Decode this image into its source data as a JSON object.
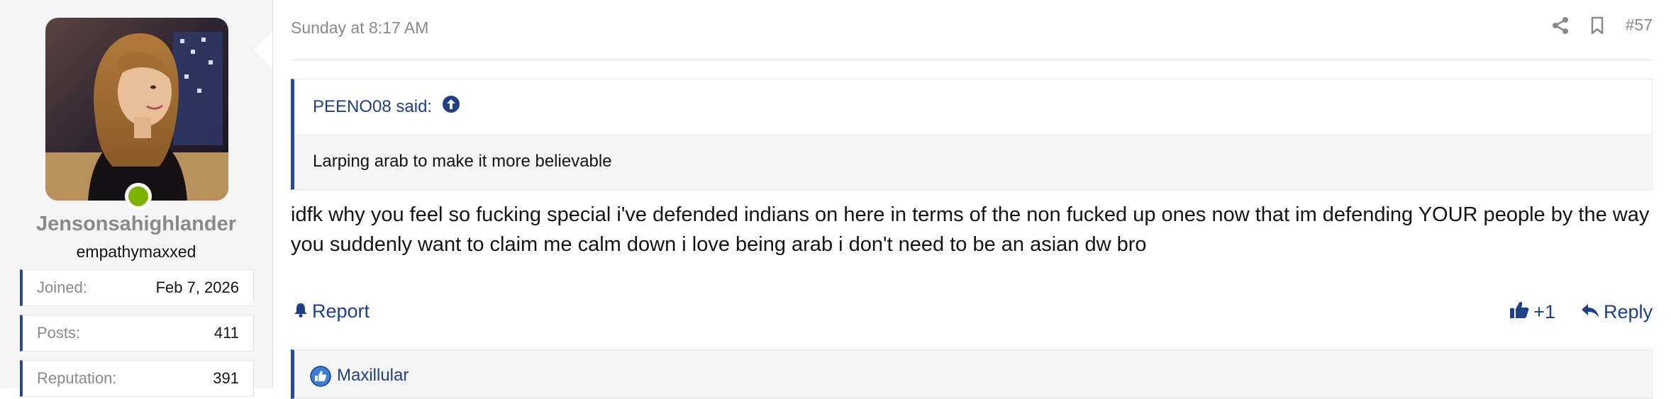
{
  "user": {
    "name": "Jensonsahighlander",
    "title": "empathymaxxed",
    "online": true,
    "stats": [
      {
        "label": "Joined:",
        "value": "Feb 7, 2026"
      },
      {
        "label": "Posts:",
        "value": "411"
      },
      {
        "label": "Reputation:",
        "value": "391"
      }
    ]
  },
  "post": {
    "date": "Sunday at 8:17 AM",
    "number": "#57",
    "quote": {
      "author": "PEENO08 said:",
      "text": "Larping arab to make it more believable"
    },
    "message": "idfk why you feel so fucking special i've defended indians on here in terms of the non fucked up ones now that im defending YOUR people by the way you suddenly want to claim me calm down i love being arab i don't need to be an asian dw bro",
    "actions": {
      "report": "Report",
      "like": "+1",
      "reply": "Reply"
    },
    "reactions": {
      "users": "Maxillular"
    }
  },
  "colors": {
    "accent": "#2a4a8c",
    "link": "#1f3f86",
    "online": "#7cb300",
    "muted": "#8a8a8a",
    "panel": "#f5f5f5"
  },
  "icons": [
    "share-icon",
    "bookmark-icon",
    "arrow-up-circle-icon",
    "bell-icon",
    "thumbs-up-icon",
    "reply-icon",
    "like-reaction-icon"
  ]
}
